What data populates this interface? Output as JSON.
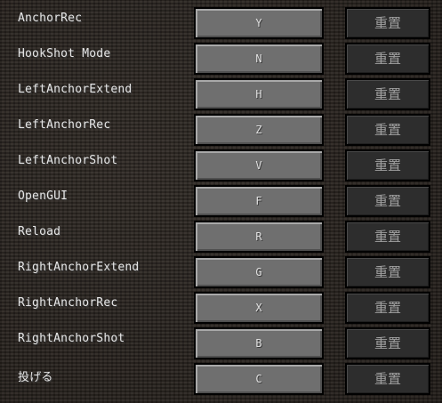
{
  "controls": [
    {
      "action": "AnchorRec",
      "key": "Y",
      "reset": "重置"
    },
    {
      "action": "HookShot Mode",
      "key": "N",
      "reset": "重置"
    },
    {
      "action": "LeftAnchorExtend",
      "key": "H",
      "reset": "重置"
    },
    {
      "action": "LeftAnchorRec",
      "key": "Z",
      "reset": "重置"
    },
    {
      "action": "LeftAnchorShot",
      "key": "V",
      "reset": "重置"
    },
    {
      "action": "OpenGUI",
      "key": "F",
      "reset": "重置"
    },
    {
      "action": "Reload",
      "key": "R",
      "reset": "重置"
    },
    {
      "action": "RightAnchorExtend",
      "key": "G",
      "reset": "重置"
    },
    {
      "action": "RightAnchorRec",
      "key": "X",
      "reset": "重置"
    },
    {
      "action": "RightAnchorShot",
      "key": "B",
      "reset": "重置"
    },
    {
      "action": "投げる",
      "key": "C",
      "reset": "重置"
    }
  ]
}
